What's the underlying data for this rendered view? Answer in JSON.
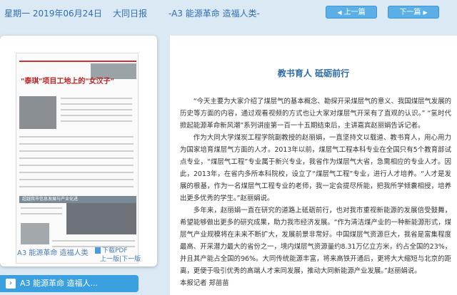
{
  "header": {
    "date": "星期一 2019年06月24日",
    "newspaper": "大同日报",
    "section": "-A3 能源革命 造福人类-",
    "prev_label": "上一篇",
    "next_label": "下一篇"
  },
  "left_panel": {
    "thumbnail": {
      "headline": "\"泰琪\"项目工地上的\"女汉子\"",
      "banner": "超越我市信息发展与产业化进"
    },
    "caption": "A3 能源革命 造福人类",
    "pdf_label": "下载PDF",
    "prev_page": "上一版",
    "separator": "|",
    "next_page": "下一版"
  },
  "section_bar": {
    "label": "A3 能源革命 造福人..."
  },
  "article": {
    "title": "教书育人 砥砺前行",
    "paragraphs": [
      "“今天主要为大家介绍了煤层气的基本概念、勘探开采煤层气的意义、我国煤层气发展的历史等方面的内容，通过观看视频的方式也让大家对煤层气开采有了直观的认识。” “氢时代掀起能源革命新风潮”系列讲座第一百一十五期结束后，主讲嘉宾赵丽娟告诉记者。",
      "作为大同大学煤炭工程学院副教授的赵丽娟，一直坚持文以载道、教书育人，用心用力为国家培育煤层气方面的人才。2013年以前，煤层气工程本科专业在全国只有5个教育部试点专业，“煤层气工程”专业属于新兴专业，我省作为煤层气大省，急需相应的专业人才。因此，2013年，在省内多所本科院校，设立了“煤层气工程”专业，进行人才培养。“人才是发展的根基，作为一名煤层气工程专业的老师，我一定会提尽所能，把我所学倾囊相授，培养出更多优秀的学生。”赵丽娟说。",
      "多年来，赵丽娟一直在研究的道路上砥砺前行，也对我市重视新能源的发展倍受鼓舞，希望能够做出更多的研究成果，助力我市经济发展。“作为清洁煤产业的一种新能源形式，煤层气产业规模将在未来不断扩大，发展前景非常好。中国煤层气资源巨大，我省是富集程度最高、开采潜力最大的省份之一，境内煤层气资源量约8.31万亿立方米，约占全国的23%，并且其产能占全国的96%。大同传统能源丰富，将来高铁开通后，更将大大缩短与北京的距离，更便于吸引优秀的高端人才来同发展，推动大同新能源产业发展。”赵丽娟说。"
    ],
    "byline": "本报记者 郑苗苗"
  }
}
